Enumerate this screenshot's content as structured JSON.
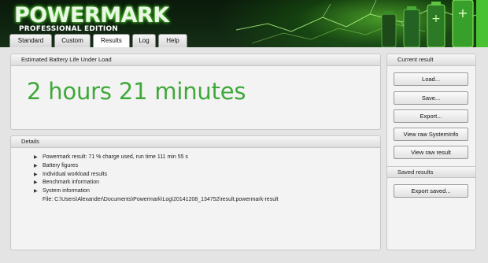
{
  "app": {
    "logo": "POWERMARK",
    "edition": "PROFESSIONAL EDITION"
  },
  "tabs": [
    {
      "label": "Standard"
    },
    {
      "label": "Custom"
    },
    {
      "label": "Results",
      "active": true
    },
    {
      "label": "Log"
    },
    {
      "label": "Help"
    }
  ],
  "estimate": {
    "header": "Estimated Battery Life Under Load",
    "value": "2 hours 21 minutes"
  },
  "details": {
    "header": "Details",
    "items": [
      "Powermark result: 71 % charge used, run time 111 min 55 s",
      "Battery figures",
      "Individual workload results",
      "Benchmark information",
      "System information"
    ],
    "file_path": "File: C:\\Users\\Alexander\\Documents\\Powermark\\Log\\20141208_134752\\result.powermark-result"
  },
  "current_result": {
    "header": "Current result",
    "buttons": [
      "Load...",
      "Save...",
      "Export...",
      "View raw SystemInfo",
      "View raw result"
    ]
  },
  "saved_results": {
    "header": "Saved results",
    "buttons": [
      "Export saved..."
    ]
  },
  "colors": {
    "accent_green": "#3fa83a",
    "banner_dark": "#0b1a0b"
  }
}
